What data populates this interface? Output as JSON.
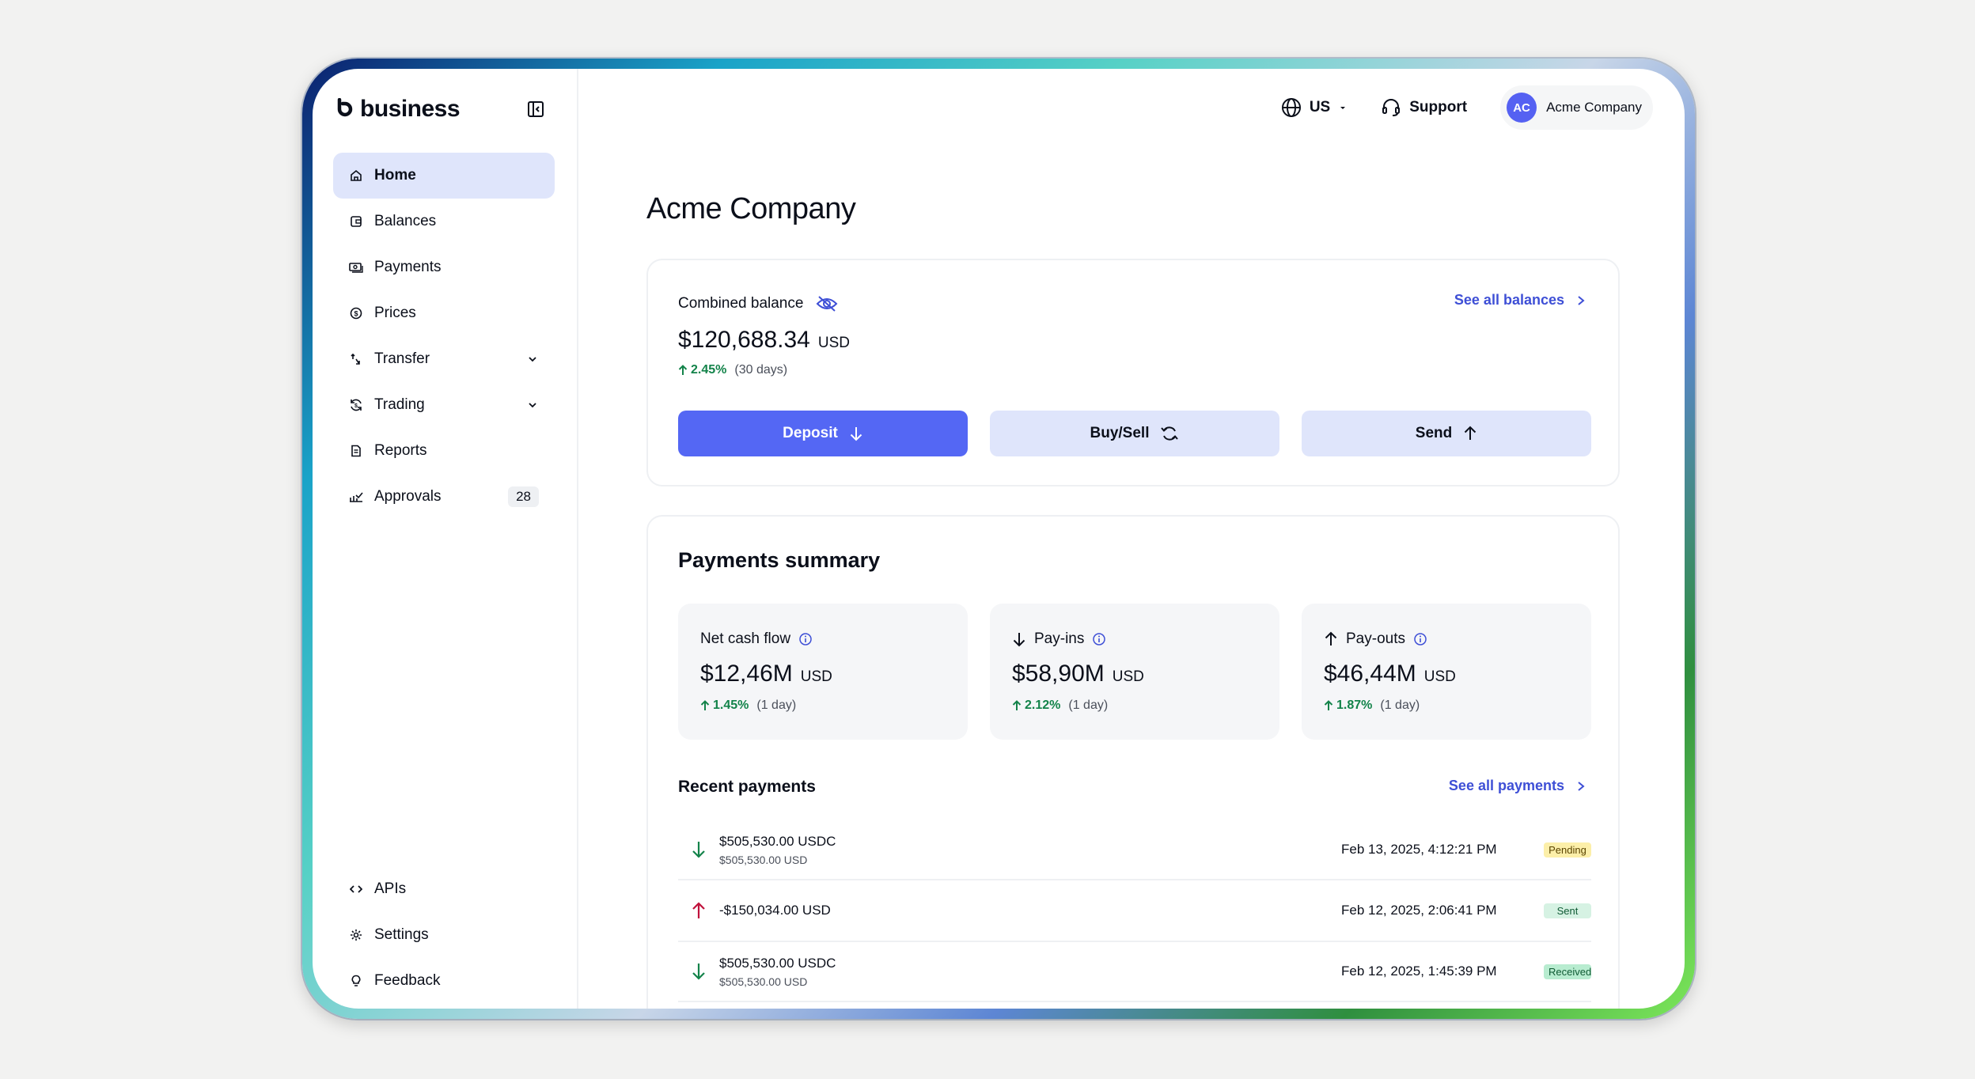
{
  "brand": {
    "name": "business"
  },
  "colors": {
    "accent": "#5467f4",
    "link": "#3e4fd6",
    "positive": "#13834a",
    "negative": "#c0123c",
    "active_nav": "#dfe5fb"
  },
  "sidebar": {
    "items": [
      {
        "label": "Home",
        "icon": "home-icon",
        "active": true
      },
      {
        "label": "Balances",
        "icon": "wallet-icon"
      },
      {
        "label": "Payments",
        "icon": "cash-icon"
      },
      {
        "label": "Prices",
        "icon": "dollar-circle-icon"
      },
      {
        "label": "Transfer",
        "icon": "transfer-icon",
        "expandable": true
      },
      {
        "label": "Trading",
        "icon": "trading-icon",
        "expandable": true
      },
      {
        "label": "Reports",
        "icon": "document-icon"
      },
      {
        "label": "Approvals",
        "icon": "approvals-icon",
        "count": "28"
      }
    ],
    "bottom": [
      {
        "label": "APIs",
        "icon": "code-icon"
      },
      {
        "label": "Settings",
        "icon": "gear-icon"
      },
      {
        "label": "Feedback",
        "icon": "lightbulb-icon"
      }
    ]
  },
  "topbar": {
    "region": "US",
    "support": "Support",
    "account_initials": "AC",
    "account_name": "Acme Company"
  },
  "page": {
    "title": "Acme Company"
  },
  "balance": {
    "label": "Combined balance",
    "see_all": "See all balances",
    "amount": "$120,688.34",
    "currency": "USD",
    "change": "2.45%",
    "period": "(30 days)",
    "actions": {
      "deposit": "Deposit",
      "buysell": "Buy/Sell",
      "send": "Send"
    }
  },
  "summary": {
    "title": "Payments summary",
    "metrics": [
      {
        "label": "Net cash flow",
        "value": "$12,46M",
        "currency": "USD",
        "change": "1.45%",
        "period": "(1 day)"
      },
      {
        "label": "Pay-ins",
        "value": "$58,90M",
        "currency": "USD",
        "change": "2.12%",
        "period": "(1 day)"
      },
      {
        "label": "Pay-outs",
        "value": "$46,44M",
        "currency": "USD",
        "change": "1.87%",
        "period": "(1 day)"
      }
    ],
    "recent_title": "Recent payments",
    "see_all": "See all payments",
    "payments": [
      {
        "direction": "in",
        "amount": "$505,530.00 USDC",
        "sub": "$505,530.00 USD",
        "date": "Feb 13, 2025, 4:12:21 PM",
        "status": "Pending"
      },
      {
        "direction": "out",
        "amount": "-$150,034.00 USD",
        "sub": "",
        "date": "Feb 12, 2025, 2:06:41 PM",
        "status": "Sent"
      },
      {
        "direction": "in",
        "amount": "$505,530.00 USDC",
        "sub": "$505,530.00 USD",
        "date": "Feb 12, 2025, 1:45:39 PM",
        "status": "Received"
      }
    ]
  }
}
